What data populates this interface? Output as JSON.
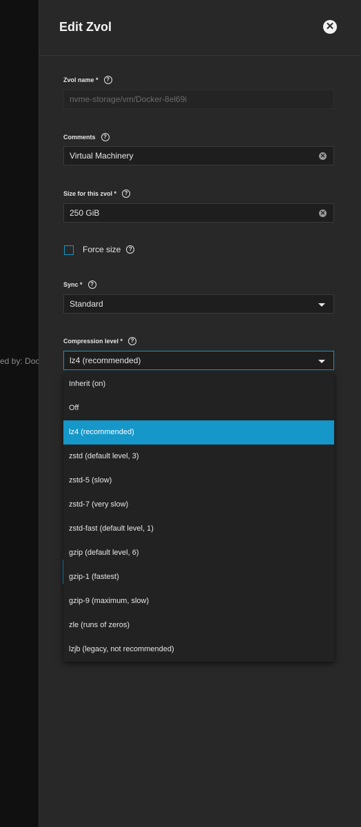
{
  "backdrop": {
    "text": "ed by: Doc"
  },
  "panel": {
    "title": "Edit Zvol"
  },
  "fields": {
    "name": {
      "label": "Zvol name *",
      "value": "nvme-storage/vm/Docker-8el69i"
    },
    "comments": {
      "label": "Comments",
      "value": "Virtual Machinery"
    },
    "size": {
      "label": "Size for this zvol *",
      "value": "250 GiB"
    },
    "force_size": {
      "label": "Force size",
      "checked": false
    },
    "sync": {
      "label": "Sync *",
      "value": "Standard"
    },
    "compression": {
      "label": "Compression level *",
      "value": "lz4 (recommended)"
    }
  },
  "compression_options": [
    "Inherit (on)",
    "Off",
    "lz4 (recommended)",
    "zstd (default level, 3)",
    "zstd-5 (slow)",
    "zstd-7 (very slow)",
    "zstd-fast (default level, 1)",
    "gzip (default level, 6)",
    "gzip-1 (fastest)",
    "gzip-9 (maximum, slow)",
    "zle (runs of zeros)",
    "lzjb (legacy, not recommended)"
  ],
  "selected_option": "lz4 (recommended)",
  "colors": {
    "accent": "#1597c9",
    "panel": "#282828",
    "field": "#1e1e1e"
  }
}
